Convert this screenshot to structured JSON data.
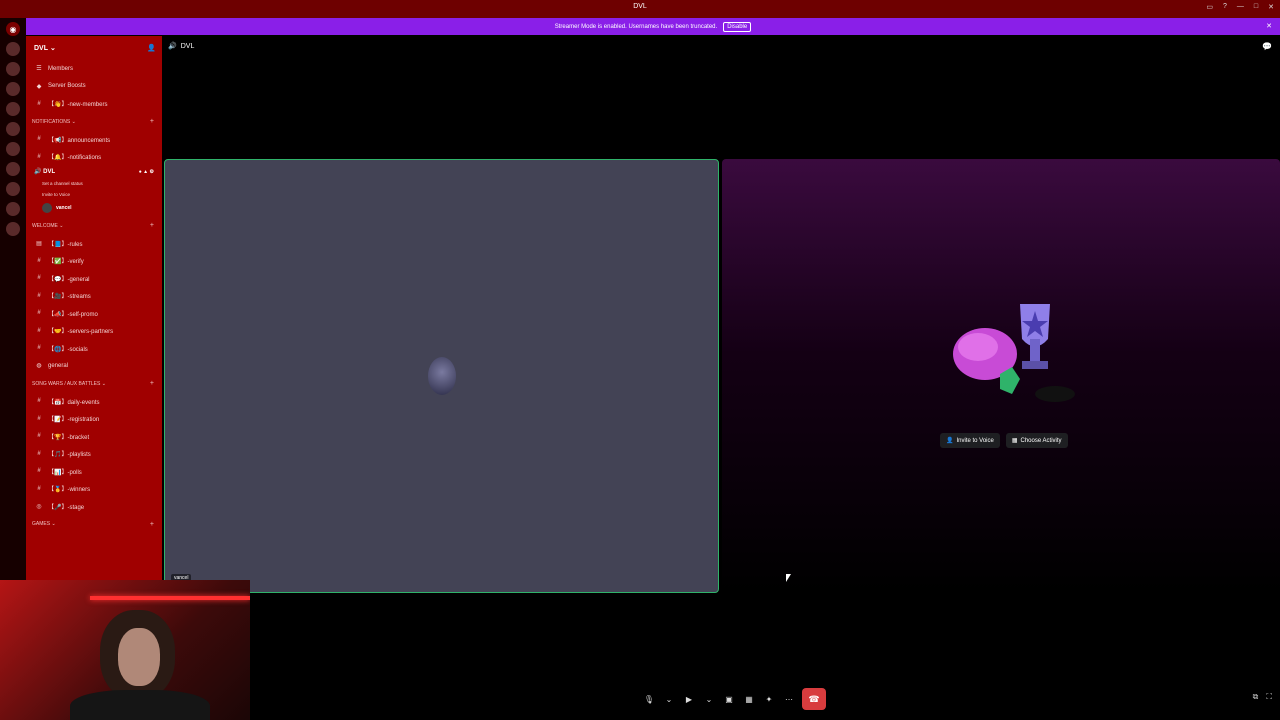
{
  "window": {
    "title": "DVL"
  },
  "banner": {
    "text": "Streamer Mode is enabled. Usernames have been truncated.",
    "disable_label": "Disable"
  },
  "server": {
    "name": "DVL"
  },
  "sidebar": {
    "top_items": [
      {
        "icon": "members-icon",
        "label": "Members"
      },
      {
        "icon": "boosts-icon",
        "label": "Server Boosts"
      }
    ],
    "pre_channels": [
      {
        "label": "【👋】-new-members"
      }
    ],
    "categories": [
      {
        "name": "NOTIFICATIONS",
        "channels": [
          {
            "label": "【📢】announcements"
          },
          {
            "label": "【🔔】-notifications"
          }
        ]
      },
      {
        "name": "WELCOME",
        "channels": [
          {
            "label": "【📘】-rules"
          },
          {
            "label": "【✅】-verify"
          },
          {
            "label": "【💬】-general"
          },
          {
            "label": "【🎥】-streams"
          },
          {
            "label": "【📣】-self-promo"
          },
          {
            "label": "【🤝】-servers-partners"
          },
          {
            "label": "【🌐】-socials"
          },
          {
            "label": "general"
          }
        ]
      },
      {
        "name": "SONG WARS / AUX BATTLES",
        "channels": [
          {
            "label": "【📅】daily-events"
          },
          {
            "label": "【📝】-registration"
          },
          {
            "label": "【🏆】-bracket"
          },
          {
            "label": "【🎵】-playlists"
          },
          {
            "label": "【📊】-polls"
          },
          {
            "label": "【🥇】-winners"
          },
          {
            "label": "【🎤】-stage"
          }
        ]
      },
      {
        "name": "GAMES",
        "channels": []
      }
    ],
    "voice_channel": {
      "name": "DVL",
      "status": "Set a channel status",
      "invite": "Invite to Voice",
      "user": "vancel"
    }
  },
  "header": {
    "channel": "DVL"
  },
  "stage": {
    "left_tile_name": "vancel",
    "invite_label": "Invite to Voice",
    "activity_label": "Choose Activity"
  }
}
